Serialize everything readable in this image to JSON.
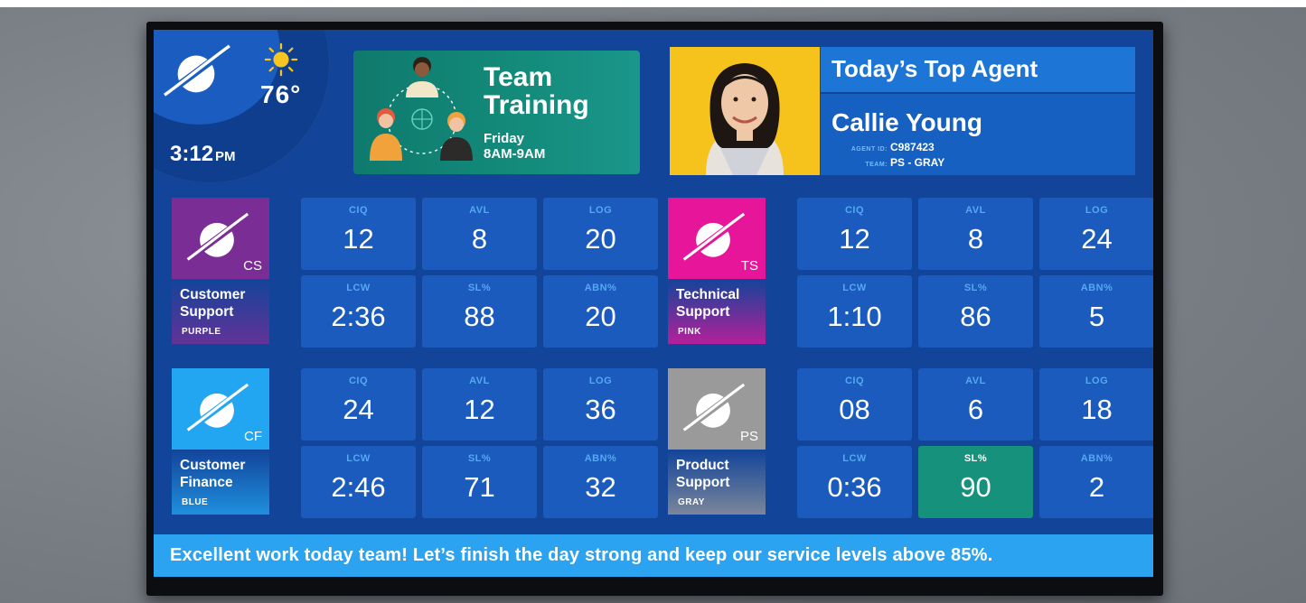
{
  "header": {
    "weather": {
      "temperature": "76°",
      "icon": "sun-icon"
    },
    "clock": {
      "time": "3:12",
      "ampm": "PM"
    },
    "brand_icon": "planet-logo-icon"
  },
  "training": {
    "title": "Team Training",
    "day": "Friday",
    "time": "8AM-9AM",
    "icon": "team-people-icon"
  },
  "top_agent": {
    "heading": "Today’s Top Agent",
    "name": "Callie Young",
    "agent_id_label": "AGENT ID:",
    "agent_id": "C987423",
    "team_label": "TEAM:",
    "team": "PS - GRAY"
  },
  "teams": [
    {
      "code": "CS",
      "name_line1": "Customer",
      "name_line2": "Support",
      "color_name": "PURPLE",
      "color": "#7b2d96",
      "metrics": [
        {
          "label": "CIQ",
          "value": "12"
        },
        {
          "label": "AVL",
          "value": "8"
        },
        {
          "label": "LOG",
          "value": "20"
        },
        {
          "label": "LCW",
          "value": "2:36"
        },
        {
          "label": "SL%",
          "value": "88"
        },
        {
          "label": "ABN%",
          "value": "20"
        }
      ]
    },
    {
      "code": "TS",
      "name_line1": "Technical",
      "name_line2": "Support",
      "color_name": "PINK",
      "color": "#e6159a",
      "metrics": [
        {
          "label": "CIQ",
          "value": "12"
        },
        {
          "label": "AVL",
          "value": "8"
        },
        {
          "label": "LOG",
          "value": "24"
        },
        {
          "label": "LCW",
          "value": "1:10"
        },
        {
          "label": "SL%",
          "value": "86"
        },
        {
          "label": "ABN%",
          "value": "5"
        }
      ]
    },
    {
      "code": "CF",
      "name_line1": "Customer",
      "name_line2": "Finance",
      "color_name": "BLUE",
      "color": "#23a6f2",
      "metrics": [
        {
          "label": "CIQ",
          "value": "24"
        },
        {
          "label": "AVL",
          "value": "12"
        },
        {
          "label": "LOG",
          "value": "36"
        },
        {
          "label": "LCW",
          "value": "2:46"
        },
        {
          "label": "SL%",
          "value": "71"
        },
        {
          "label": "ABN%",
          "value": "32"
        }
      ]
    },
    {
      "code": "PS",
      "name_line1": "Product",
      "name_line2": "Support",
      "color_name": "GRAY",
      "color": "#9a9a9a",
      "metrics": [
        {
          "label": "CIQ",
          "value": "08"
        },
        {
          "label": "AVL",
          "value": "6"
        },
        {
          "label": "LOG",
          "value": "18"
        },
        {
          "label": "LCW",
          "value": "0:36"
        },
        {
          "label": "SL%",
          "value": "90",
          "highlight": true
        },
        {
          "label": "ABN%",
          "value": "2"
        }
      ]
    }
  ],
  "ticker": {
    "message": "Excellent work today team!  Let’s finish the day strong and keep our service levels above 85%."
  },
  "colors": {
    "screen_bg": "#12449a",
    "tile_bg": "#1a5bbd",
    "highlight": "#16927c",
    "ticker": "#2ba3f0",
    "agent_photo_bg": "#f6c31c"
  }
}
